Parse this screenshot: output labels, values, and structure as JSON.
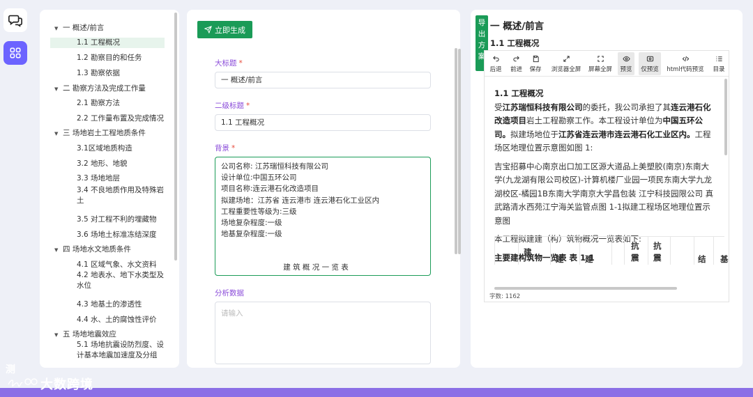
{
  "sidebar": {
    "chat_icon": "chat-bubbles-icon",
    "grid_icon": "app-grid-icon"
  },
  "tree": {
    "items": [
      {
        "label": "一 概述/前言",
        "level": "parent"
      },
      {
        "label": "1.1 工程概况",
        "level": "child",
        "selected": true
      },
      {
        "label": "1.2 勘察目的和任务",
        "level": "child"
      },
      {
        "label": "1.3 勘察依据",
        "level": "child"
      },
      {
        "label": "二 勘察方法及完成工作量",
        "level": "parent"
      },
      {
        "label": "2.1 勘察方法",
        "level": "child"
      },
      {
        "label": "2.2 工作量布置及完成情况",
        "level": "child"
      },
      {
        "label": "三 场地岩土工程地质条件",
        "level": "parent"
      },
      {
        "label": "3.1区域地质构造",
        "level": "child"
      },
      {
        "label": "3.2 地形、地貌",
        "level": "child"
      },
      {
        "label": "3.3 场地地层",
        "level": "child"
      },
      {
        "label": "3.4 不良地质作用及特殊岩土",
        "level": "child"
      },
      {
        "label": "3.5 对工程不利的埋藏物",
        "level": "child"
      },
      {
        "label": "3.6 场地土标准冻结深度",
        "level": "child"
      },
      {
        "label": "四 场地水文地质条件",
        "level": "parent"
      },
      {
        "label": "4.1 区域气象、水文资料",
        "level": "child"
      },
      {
        "label": "4.2 地表水、地下水类型及水位",
        "level": "child"
      },
      {
        "label": "4.3 地基土的渗透性",
        "level": "child"
      },
      {
        "label": "4.4 水、土的腐蚀性评价",
        "level": "child"
      },
      {
        "label": "五 场地地震效应",
        "level": "parent"
      },
      {
        "label": "5.1 场地抗震设防烈度、设计基本地震加速度及分组",
        "level": "child"
      }
    ]
  },
  "form": {
    "generate_label": "立即生成",
    "title_label": "大标题",
    "title_value": "一 概述/前言",
    "subtitle_label": "二级标题",
    "subtitle_value": "1.1 工程概况",
    "background_label": "背景",
    "background_lines": [
      "公司名称: 江苏瑞恒科技有限公司",
      "设计单位:中国五环公司",
      "项目名称:连云港石化改造项目",
      "拟建场地：江苏省 连云港市 连云港石化工业区内",
      "工程重要性等级为:三级",
      "场地复杂程度:一级",
      "地基复杂程度:一级",
      "",
      "",
      "建 筑 概 况 一 览 表"
    ],
    "analysis_label": "分析数据",
    "analysis_placeholder": "请输入",
    "required_mark": "*"
  },
  "preview": {
    "export_label": "导出方案",
    "heading1": "一 概述/前言",
    "heading2": "1.1 工程概况",
    "toolbar": [
      {
        "label": "后退",
        "icon": "undo-icon"
      },
      {
        "label": "前进",
        "icon": "redo-icon"
      },
      {
        "label": "保存",
        "icon": "save-icon"
      },
      {
        "label": "浏览器全屏",
        "icon": "browser-fullscreen-icon"
      },
      {
        "label": "屏幕全屏",
        "icon": "screen-fullscreen-icon"
      },
      {
        "label": "预览",
        "icon": "eye-icon",
        "active": true
      },
      {
        "label": "仅预览",
        "icon": "preview-only-icon",
        "active": true
      },
      {
        "label": "html代码预览",
        "icon": "code-icon"
      },
      {
        "label": "目录",
        "icon": "toc-icon"
      }
    ],
    "content_title": "1.1 工程概况",
    "para1_a": "受",
    "para1_company": "江苏瑞恒科技有限公司",
    "para1_b": "的委托，我公司承担了其",
    "para1_project": "连云港石化改造项目",
    "para1_c": "岩土工程勘察工作。本工程设计单位为",
    "para1_designer": "中国五环公司。",
    "para1_d": "拟建场地位于",
    "para1_site": "江苏省连云港市连云港石化工业区内。",
    "para1_e": "工程场区地理位置示意图如图 1:",
    "para2": "吉宝招募中心南京出口加工区源大道品上美塑胶(南京)东南大学(九龙湖有限公司校区)-计算机楼厂业园一项民东南大学九龙湖校区-橘园1B东南大学南京大学昌包装 江宁科技园限公司 真武路清水西苑江宁海关监管点图 1-1拟建工程场区地理位置示意图",
    "para3": "本工程拟建建（构）筑物概况一览表如下:",
    "table_title": "主要建构筑物一览表 表 1-1",
    "table_headers": [
      "建",
      "建",
      "建",
      "抗震",
      "抗震",
      "结",
      "基"
    ],
    "word_count_label": "字数:",
    "word_count": "1162"
  },
  "watermark": {
    "badge": "测",
    "text": "大数跨境"
  }
}
